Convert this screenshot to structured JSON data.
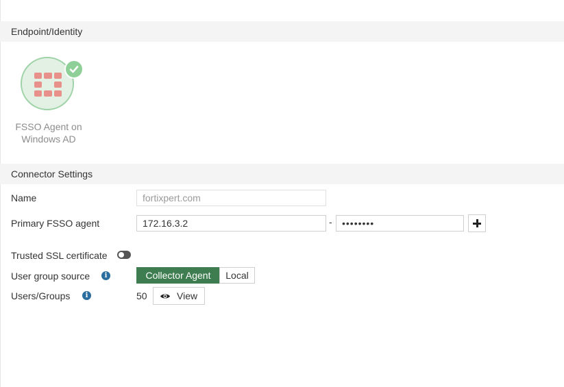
{
  "sections": {
    "endpoint_identity": "Endpoint/Identity",
    "connector_settings": "Connector Settings"
  },
  "connector_card": {
    "label_line1": "FSSO Agent on",
    "label_line2": "Windows AD",
    "logo_icon": "fortinet-firewall-icon",
    "status_icon": "check-circle-icon",
    "circle_color": "#e3f1e5",
    "badge_color": "#8fcf98"
  },
  "form": {
    "name": {
      "label": "Name",
      "value": "fortixpert.com"
    },
    "primary_agent": {
      "label": "Primary FSSO agent",
      "ip_value": "172.16.3.2",
      "separator": "-",
      "password_mask": "••••••••"
    },
    "trusted_ssl": {
      "label": "Trusted SSL certificate",
      "enabled": false
    },
    "user_group_source": {
      "label": "User group source",
      "options": [
        "Collector Agent",
        "Local"
      ],
      "selected": "Collector Agent"
    },
    "users_groups": {
      "label": "Users/Groups",
      "count": "50",
      "view_label": "View"
    }
  },
  "colors": {
    "accent": "#3d7d4f",
    "info": "#2a6d9e",
    "section_bg": "#f4f4f4"
  }
}
